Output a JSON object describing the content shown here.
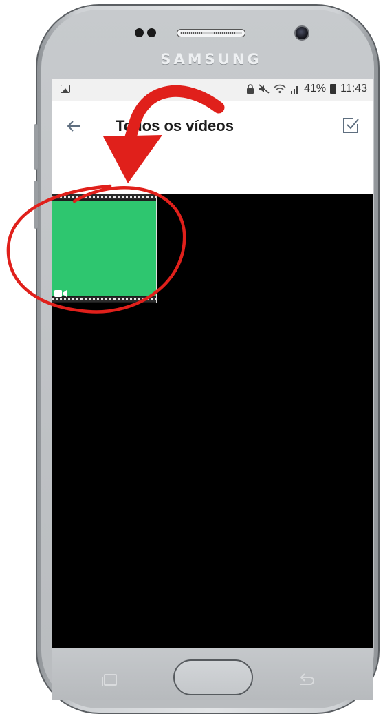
{
  "device": {
    "brand": "SAMSUNG"
  },
  "status_bar": {
    "battery_percent": "41%",
    "time": "11:43",
    "icons": [
      "gallery-notification-icon",
      "lock-icon",
      "mute-icon",
      "wifi-icon",
      "signal-icon",
      "battery-icon"
    ]
  },
  "app_bar": {
    "back_icon": "arrow-left-icon",
    "title": "Todos os vídeos",
    "select_icon": "checkbox-icon"
  },
  "grid": {
    "items": [
      {
        "type": "video",
        "thumbnail_color": "#2ec66f",
        "badge_icon": "video-camera-icon"
      }
    ]
  },
  "annotations": {
    "highlight_color": "#e0201b",
    "shapes": [
      "curved-arrow",
      "circle"
    ]
  },
  "nav_bar": {
    "buttons": [
      "recent-apps-icon",
      "home-button",
      "back-key-icon"
    ]
  }
}
